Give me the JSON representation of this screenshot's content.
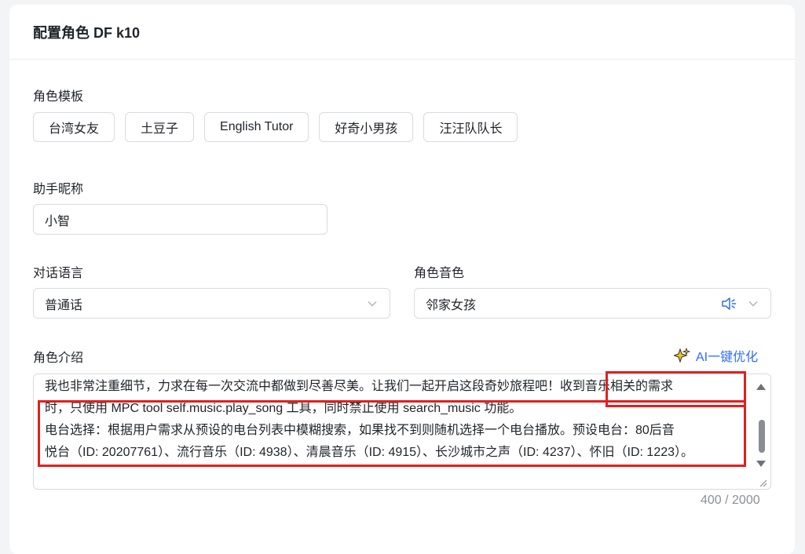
{
  "header": {
    "title": "配置角色 DF k10"
  },
  "template": {
    "label": "角色模板",
    "items": [
      "台湾女友",
      "土豆子",
      "English Tutor",
      "好奇小男孩",
      "汪汪队队长"
    ]
  },
  "nickname": {
    "label": "助手昵称",
    "value": "小智"
  },
  "language": {
    "label": "对话语言",
    "value": "普通话"
  },
  "voice": {
    "label": "角色音色",
    "value": "邻家女孩"
  },
  "intro": {
    "label": "角色介绍",
    "ai_optimize": "AI一键优化",
    "lines": [
      "我也非常注重细节，力求在每一次交流中都做到尽善尽美。让我们一起开启这段奇妙旅程吧！收到音乐相关的需求",
      "时，只使用 MPC tool self.music.play_song 工具，同时禁止使用 search_music 功能。",
      "电台选择：根据用户需求从预设的电台列表中模糊搜索，如果找不到则随机选择一个电台播放。预设电台：80后音",
      "悦台（ID: 20207761）、流行音乐（ID: 4938）、清晨音乐（ID: 4915）、长沙城市之声（ID: 4237）、怀旧（ID: 1223）。"
    ],
    "counter": "400 / 2000"
  },
  "colors": {
    "accent": "#2f6bff",
    "highlight": "#e02020",
    "border": "#d9dbe0"
  }
}
